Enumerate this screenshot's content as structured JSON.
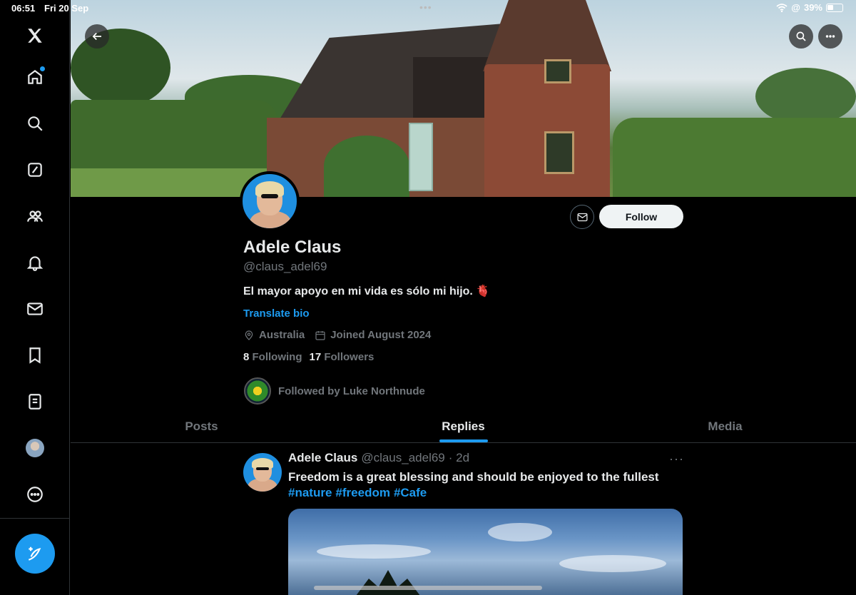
{
  "status_bar": {
    "time": "06:51",
    "date": "Fri 20 Sep",
    "battery": "39%"
  },
  "sidebar": {
    "items": [
      {
        "name": "x-logo"
      },
      {
        "name": "home"
      },
      {
        "name": "explore"
      },
      {
        "name": "grok"
      },
      {
        "name": "communities"
      },
      {
        "name": "notifications"
      },
      {
        "name": "messages"
      },
      {
        "name": "bookmarks"
      },
      {
        "name": "lists"
      },
      {
        "name": "profile"
      },
      {
        "name": "more"
      }
    ],
    "compose": "compose-post"
  },
  "profile": {
    "display_name": "Adele Claus",
    "handle": "@claus_adel69",
    "bio": "El mayor apoyo en mi vida es sólo mi hijo. 🫀",
    "translate_label": "Translate bio",
    "location": "Australia",
    "joined": "Joined August 2024",
    "following_count": "8",
    "following_label": "Following",
    "followers_count": "17",
    "followers_label": "Followers",
    "followed_by": "Followed by Luke Northnude",
    "follow_label": "Follow"
  },
  "tabs": [
    "Posts",
    "Replies",
    "Media"
  ],
  "active_tab": "Replies",
  "post": {
    "name": "Adele Claus",
    "handle": "@claus_adel69",
    "time": "· 2d",
    "more": "···",
    "text": "Freedom is a great blessing and should be enjoyed to the fullest",
    "hashtags": [
      "#nature",
      "#freedom",
      "#Cafe"
    ]
  },
  "colors": {
    "accent": "#1d9bf0",
    "background": "#000000",
    "muted": "#71767b"
  }
}
